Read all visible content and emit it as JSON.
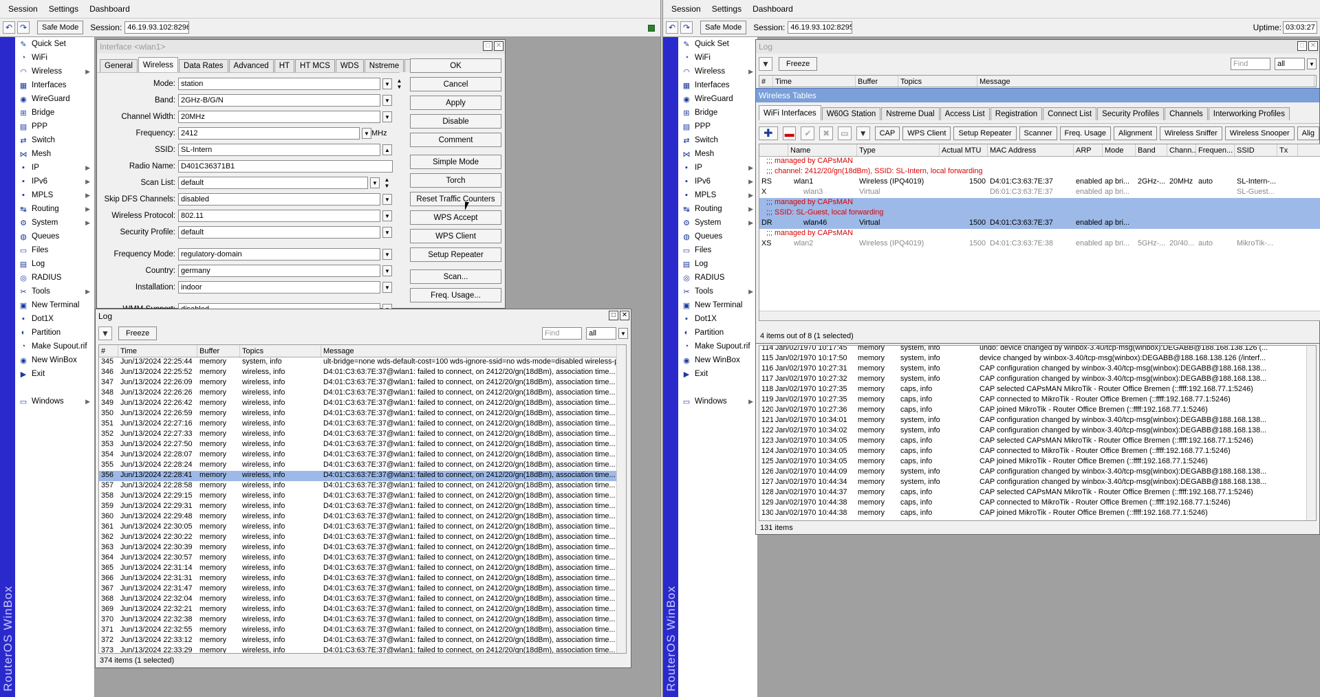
{
  "left": {
    "menu": [
      "Session",
      "Settings",
      "Dashboard"
    ],
    "toolbar": {
      "undo_icon": "undo-icon",
      "redo_icon": "redo-icon",
      "safe_mode": "Safe Mode",
      "session_label": "Session:",
      "session_value": "46.19.93.102:8296"
    },
    "brand": "RouterOS WinBox",
    "sidebar": [
      {
        "label": "Quick Set",
        "icon": "quickset-icon",
        "glyph": "✎"
      },
      {
        "label": "WiFi",
        "icon": "wifi-icon",
        "glyph": "◔"
      },
      {
        "label": "Wireless",
        "icon": "wireless-icon",
        "glyph": "◠",
        "sub": true
      },
      {
        "label": "Interfaces",
        "icon": "interfaces-icon",
        "glyph": "▦"
      },
      {
        "label": "WireGuard",
        "icon": "wireguard-icon",
        "glyph": "◉"
      },
      {
        "label": "Bridge",
        "icon": "bridge-icon",
        "glyph": "⊞"
      },
      {
        "label": "PPP",
        "icon": "ppp-icon",
        "glyph": "▤"
      },
      {
        "label": "Switch",
        "icon": "switch-icon",
        "glyph": "⇄"
      },
      {
        "label": "Mesh",
        "icon": "mesh-icon",
        "glyph": "⋈"
      },
      {
        "label": "IP",
        "icon": "ip-icon",
        "glyph": "▪",
        "sub": true
      },
      {
        "label": "IPv6",
        "icon": "ipv6-icon",
        "glyph": "▪",
        "sub": true
      },
      {
        "label": "MPLS",
        "icon": "mpls-icon",
        "glyph": "▪",
        "sub": true
      },
      {
        "label": "Routing",
        "icon": "routing-icon",
        "glyph": "↹",
        "sub": true
      },
      {
        "label": "System",
        "icon": "system-icon",
        "glyph": "⚙",
        "sub": true
      },
      {
        "label": "Queues",
        "icon": "queues-icon",
        "glyph": "◍"
      },
      {
        "label": "Files",
        "icon": "files-icon",
        "glyph": "▭"
      },
      {
        "label": "Log",
        "icon": "log-icon",
        "glyph": "▤"
      },
      {
        "label": "RADIUS",
        "icon": "radius-icon",
        "glyph": "◎"
      },
      {
        "label": "Tools",
        "icon": "tools-icon",
        "glyph": "✂",
        "sub": true
      },
      {
        "label": "New Terminal",
        "icon": "terminal-icon",
        "glyph": "▣"
      },
      {
        "label": "Dot1X",
        "icon": "dot1x-icon",
        "glyph": "▪"
      },
      {
        "label": "Partition",
        "icon": "partition-icon",
        "glyph": "◐"
      },
      {
        "label": "Make Supout.rif",
        "icon": "supout-icon",
        "glyph": "◔"
      },
      {
        "label": "New WinBox",
        "icon": "winbox-icon",
        "glyph": "◉"
      },
      {
        "label": "Exit",
        "icon": "exit-icon",
        "glyph": "▶"
      },
      {
        "label": "Windows",
        "icon": "windows-icon",
        "glyph": "▭",
        "sub": true,
        "gap": true
      }
    ],
    "iface_window": {
      "title": "Interface <wlan1>",
      "tabs": [
        "General",
        "Wireless",
        "Data Rates",
        "Advanced",
        "HT",
        "HT MCS",
        "WDS",
        "Nstreme",
        "..."
      ],
      "active_tab": "Wireless",
      "fields": [
        {
          "label": "Mode:",
          "value": "station",
          "ctrl": "dd",
          "extra": "▲▼"
        },
        {
          "label": "Band:",
          "value": "2GHz-B/G/N",
          "ctrl": "dd"
        },
        {
          "label": "Channel Width:",
          "value": "20MHz",
          "ctrl": "dd"
        },
        {
          "label": "Frequency:",
          "value": "2412",
          "ctrl": "dd",
          "unit": "MHz"
        },
        {
          "label": "SSID:",
          "value": "SL-Intern",
          "ctrl": "up"
        },
        {
          "label": "Radio Name:",
          "value": "D401C36371B1",
          "ctrl": "none"
        },
        {
          "label": "Scan List:",
          "value": "default",
          "ctrl": "dd",
          "extra": "▲▼"
        },
        {
          "label": "Skip DFS Channels:",
          "value": "disabled",
          "ctrl": "dd"
        },
        {
          "label": "Wireless Protocol:",
          "value": "802.11",
          "ctrl": "dd"
        },
        {
          "label": "Security Profile:",
          "value": "default",
          "ctrl": "dd"
        },
        {
          "label": "Frequency Mode:",
          "value": "regulatory-domain",
          "ctrl": "dd"
        },
        {
          "label": "Country:",
          "value": "germany",
          "ctrl": "dd"
        },
        {
          "label": "Installation:",
          "value": "indoor",
          "ctrl": "dd"
        },
        {
          "label": "WMM Support:",
          "value": "disabled",
          "ctrl": "dd"
        }
      ],
      "buttons": [
        "OK",
        "Cancel",
        "Apply",
        "Disable",
        "Comment",
        "Simple Mode",
        "Torch",
        "Reset Traffic Counters",
        "WPS Accept",
        "WPS Client",
        "Setup Repeater",
        "Scan...",
        "Freq. Usage..."
      ]
    },
    "log_window": {
      "title": "Log",
      "freeze": "Freeze",
      "find_placeholder": "Find",
      "filter": "all",
      "columns": [
        "#",
        "Time",
        "Buffer",
        "Topics",
        "Message"
      ],
      "rows": [
        [
          "345",
          "Jun/13/2024 22:25:44",
          "memory",
          "system, info",
          "ult-bridge=none wds-default-cost=100 wds-ignore-ssid=no wds-mode=disabled wireless-pr..."
        ],
        [
          "346",
          "Jun/13/2024 22:25:52",
          "memory",
          "wireless, info",
          "D4:01:C3:63:7E:37@wlan1: failed to connect, on 2412/20/gn(18dBm), association time..."
        ],
        [
          "347",
          "Jun/13/2024 22:26:09",
          "memory",
          "wireless, info",
          "D4:01:C3:63:7E:37@wlan1: failed to connect, on 2412/20/gn(18dBm), association time..."
        ],
        [
          "348",
          "Jun/13/2024 22:26:26",
          "memory",
          "wireless, info",
          "D4:01:C3:63:7E:37@wlan1: failed to connect, on 2412/20/gn(18dBm), association time..."
        ],
        [
          "349",
          "Jun/13/2024 22:26:42",
          "memory",
          "wireless, info",
          "D4:01:C3:63:7E:37@wlan1: failed to connect, on 2412/20/gn(18dBm), association time..."
        ],
        [
          "350",
          "Jun/13/2024 22:26:59",
          "memory",
          "wireless, info",
          "D4:01:C3:63:7E:37@wlan1: failed to connect, on 2412/20/gn(18dBm), association time..."
        ],
        [
          "351",
          "Jun/13/2024 22:27:16",
          "memory",
          "wireless, info",
          "D4:01:C3:63:7E:37@wlan1: failed to connect, on 2412/20/gn(18dBm), association time..."
        ],
        [
          "352",
          "Jun/13/2024 22:27:33",
          "memory",
          "wireless, info",
          "D4:01:C3:63:7E:37@wlan1: failed to connect, on 2412/20/gn(18dBm), association time..."
        ],
        [
          "353",
          "Jun/13/2024 22:27:50",
          "memory",
          "wireless, info",
          "D4:01:C3:63:7E:37@wlan1: failed to connect, on 2412/20/gn(18dBm), association time..."
        ],
        [
          "354",
          "Jun/13/2024 22:28:07",
          "memory",
          "wireless, info",
          "D4:01:C3:63:7E:37@wlan1: failed to connect, on 2412/20/gn(18dBm), association time..."
        ],
        [
          "355",
          "Jun/13/2024 22:28:24",
          "memory",
          "wireless, info",
          "D4:01:C3:63:7E:37@wlan1: failed to connect, on 2412/20/gn(18dBm), association time..."
        ],
        [
          "356",
          "Jun/13/2024 22:28:41",
          "memory",
          "wireless, info",
          "D4:01:C3:63:7E:37@wlan1: failed to connect, on 2412/20/gn(18dBm), association time..."
        ],
        [
          "357",
          "Jun/13/2024 22:28:58",
          "memory",
          "wireless, info",
          "D4:01:C3:63:7E:37@wlan1: failed to connect, on 2412/20/gn(18dBm), association time..."
        ],
        [
          "358",
          "Jun/13/2024 22:29:15",
          "memory",
          "wireless, info",
          "D4:01:C3:63:7E:37@wlan1: failed to connect, on 2412/20/gn(18dBm), association time..."
        ],
        [
          "359",
          "Jun/13/2024 22:29:31",
          "memory",
          "wireless, info",
          "D4:01:C3:63:7E:37@wlan1: failed to connect, on 2412/20/gn(18dBm), association time..."
        ],
        [
          "360",
          "Jun/13/2024 22:29:48",
          "memory",
          "wireless, info",
          "D4:01:C3:63:7E:37@wlan1: failed to connect, on 2412/20/gn(18dBm), association time..."
        ],
        [
          "361",
          "Jun/13/2024 22:30:05",
          "memory",
          "wireless, info",
          "D4:01:C3:63:7E:37@wlan1: failed to connect, on 2412/20/gn(18dBm), association time..."
        ],
        [
          "362",
          "Jun/13/2024 22:30:22",
          "memory",
          "wireless, info",
          "D4:01:C3:63:7E:37@wlan1: failed to connect, on 2412/20/gn(18dBm), association time..."
        ],
        [
          "363",
          "Jun/13/2024 22:30:39",
          "memory",
          "wireless, info",
          "D4:01:C3:63:7E:37@wlan1: failed to connect, on 2412/20/gn(18dBm), association time..."
        ],
        [
          "364",
          "Jun/13/2024 22:30:57",
          "memory",
          "wireless, info",
          "D4:01:C3:63:7E:37@wlan1: failed to connect, on 2412/20/gn(18dBm), association time..."
        ],
        [
          "365",
          "Jun/13/2024 22:31:14",
          "memory",
          "wireless, info",
          "D4:01:C3:63:7E:37@wlan1: failed to connect, on 2412/20/gn(18dBm), association time..."
        ],
        [
          "366",
          "Jun/13/2024 22:31:31",
          "memory",
          "wireless, info",
          "D4:01:C3:63:7E:37@wlan1: failed to connect, on 2412/20/gn(18dBm), association time..."
        ],
        [
          "367",
          "Jun/13/2024 22:31:47",
          "memory",
          "wireless, info",
          "D4:01:C3:63:7E:37@wlan1: failed to connect, on 2412/20/gn(18dBm), association time..."
        ],
        [
          "368",
          "Jun/13/2024 22:32:04",
          "memory",
          "wireless, info",
          "D4:01:C3:63:7E:37@wlan1: failed to connect, on 2412/20/gn(18dBm), association time..."
        ],
        [
          "369",
          "Jun/13/2024 22:32:21",
          "memory",
          "wireless, info",
          "D4:01:C3:63:7E:37@wlan1: failed to connect, on 2412/20/gn(18dBm), association time..."
        ],
        [
          "370",
          "Jun/13/2024 22:32:38",
          "memory",
          "wireless, info",
          "D4:01:C3:63:7E:37@wlan1: failed to connect, on 2412/20/gn(18dBm), association time..."
        ],
        [
          "371",
          "Jun/13/2024 22:32:55",
          "memory",
          "wireless, info",
          "D4:01:C3:63:7E:37@wlan1: failed to connect, on 2412/20/gn(18dBm), association time..."
        ],
        [
          "372",
          "Jun/13/2024 22:33:12",
          "memory",
          "wireless, info",
          "D4:01:C3:63:7E:37@wlan1: failed to connect, on 2412/20/gn(18dBm), association time..."
        ],
        [
          "373",
          "Jun/13/2024 22:33:29",
          "memory",
          "wireless, info",
          "D4:01:C3:63:7E:37@wlan1: failed to connect, on 2412/20/gn(18dBm), association time..."
        ]
      ],
      "selected": "356",
      "status": "374 items (1 selected)"
    }
  },
  "right": {
    "menu": [
      "Session",
      "Settings",
      "Dashboard"
    ],
    "toolbar": {
      "safe_mode": "Safe Mode",
      "session_label": "Session:",
      "session_value": "46.19.93.102:8295",
      "uptime_label": "Uptime:",
      "uptime_value": "03:03:27"
    },
    "brand": "RouterOS WinBox",
    "log_window": {
      "title": "Log",
      "freeze": "Freeze",
      "find_placeholder": "Find",
      "filter": "all",
      "columns": [
        "#",
        "Time",
        "Buffer",
        "Topics",
        "Message"
      ],
      "rows": [
        [
          "114",
          "Jan/02/1970 10:17:45",
          "memory",
          "system, info",
          "undo: device changed by winbox-3.40/tcp-msg(winbox):DEGABB@188.168.138.126 (..."
        ],
        [
          "115",
          "Jan/02/1970 10:17:50",
          "memory",
          "system, info",
          "device changed by winbox-3.40/tcp-msg(winbox):DEGABB@188.168.138.126 (/interf..."
        ],
        [
          "116",
          "Jan/02/1970 10:27:31",
          "memory",
          "system, info",
          "CAP configuration changed by winbox-3.40/tcp-msg(winbox):DEGABB@188.168.138..."
        ],
        [
          "117",
          "Jan/02/1970 10:27:32",
          "memory",
          "system, info",
          "CAP configuration changed by winbox-3.40/tcp-msg(winbox):DEGABB@188.168.138..."
        ],
        [
          "118",
          "Jan/02/1970 10:27:35",
          "memory",
          "caps, info",
          "CAP selected CAPsMAN MikroTik - Router Office Bremen (::ffff:192.168.77.1:5246)"
        ],
        [
          "119",
          "Jan/02/1970 10:27:35",
          "memory",
          "caps, info",
          "CAP connected to MikroTik - Router Office Bremen (::ffff:192.168.77.1:5246)"
        ],
        [
          "120",
          "Jan/02/1970 10:27:36",
          "memory",
          "caps, info",
          "CAP joined MikroTik - Router Office Bremen (::ffff:192.168.77.1:5246)"
        ],
        [
          "121",
          "Jan/02/1970 10:34:01",
          "memory",
          "system, info",
          "CAP configuration changed by winbox-3.40/tcp-msg(winbox):DEGABB@188.168.138..."
        ],
        [
          "122",
          "Jan/02/1970 10:34:02",
          "memory",
          "system, info",
          "CAP configuration changed by winbox-3.40/tcp-msg(winbox):DEGABB@188.168.138..."
        ],
        [
          "123",
          "Jan/02/1970 10:34:05",
          "memory",
          "caps, info",
          "CAP selected CAPsMAN MikroTik - Router Office Bremen (::ffff:192.168.77.1:5246)"
        ],
        [
          "124",
          "Jan/02/1970 10:34:05",
          "memory",
          "caps, info",
          "CAP connected to MikroTik - Router Office Bremen (::ffff:192.168.77.1:5246)"
        ],
        [
          "125",
          "Jan/02/1970 10:34:05",
          "memory",
          "caps, info",
          "CAP joined MikroTik - Router Office Bremen (::ffff:192.168.77.1:5246)"
        ],
        [
          "126",
          "Jan/02/1970 10:44:09",
          "memory",
          "system, info",
          "CAP configuration changed by winbox-3.40/tcp-msg(winbox):DEGABB@188.168.138..."
        ],
        [
          "127",
          "Jan/02/1970 10:44:34",
          "memory",
          "system, info",
          "CAP configuration changed by winbox-3.40/tcp-msg(winbox):DEGABB@188.168.138..."
        ],
        [
          "128",
          "Jan/02/1970 10:44:37",
          "memory",
          "caps, info",
          "CAP selected CAPsMAN MikroTik - Router Office Bremen (::ffff:192.168.77.1:5246)"
        ],
        [
          "129",
          "Jan/02/1970 10:44:38",
          "memory",
          "caps, info",
          "CAP connected to MikroTik - Router Office Bremen (::ffff:192.168.77.1:5246)"
        ],
        [
          "130",
          "Jan/02/1970 10:44:38",
          "memory",
          "caps, info",
          "CAP joined MikroTik - Router Office Bremen (::ffff:192.168.77.1:5246)"
        ]
      ],
      "status": "131 items"
    },
    "wt_window": {
      "title": "Wireless Tables",
      "tabs": [
        "WiFi Interfaces",
        "W60G Station",
        "Nstreme Dual",
        "Access List",
        "Registration",
        "Connect List",
        "Security Profiles",
        "Channels",
        "Interworking Profiles"
      ],
      "active_tab": "WiFi Interfaces",
      "buttons": [
        "CAP",
        "WPS Client",
        "Setup Repeater",
        "Scanner",
        "Freq. Usage",
        "Alignment",
        "Wireless Sniffer",
        "Wireless Snooper",
        "Alig"
      ],
      "columns": [
        "",
        "Name",
        "Type",
        "Actual MTU",
        "MAC Address",
        "ARP",
        "Mode",
        "Band",
        "Chann...",
        "Frequen...",
        "SSID",
        "Tx"
      ],
      "rows": [
        {
          "kind": "comment",
          "text": ";;; managed by CAPsMAN"
        },
        {
          "kind": "comment",
          "text": ";;; channel: 2412/20/gn(18dBm), SSID: SL-Intern, local forwarding"
        },
        {
          "kind": "row",
          "flag": "RS",
          "name": "wlan1",
          "type": "Wireless (IPQ4019)",
          "mtu": "1500",
          "mac": "D4:01:C3:63:7E:37",
          "arp": "enabled",
          "mode": "ap bri...",
          "band": "2GHz-...",
          "chan": "20MHz",
          "freq": "auto",
          "ssid": "SL-Intern-..."
        },
        {
          "kind": "row",
          "flag": "X",
          "name": "wlan3",
          "type": "Virtual",
          "mtu": "",
          "mac": "D6:01:C3:63:7E:37",
          "arp": "enabled",
          "mode": "ap bri...",
          "band": "",
          "chan": "",
          "freq": "",
          "ssid": "SL-Guest...",
          "disabled": true
        },
        {
          "kind": "comment",
          "text": ";;; managed by CAPsMAN",
          "sel": true
        },
        {
          "kind": "comment",
          "text": ";;; SSID: SL-Guest, local forwarding",
          "sel": true
        },
        {
          "kind": "row",
          "flag": "DR",
          "name": "wlan46",
          "type": "Virtual",
          "mtu": "1500",
          "mac": "D4:01:C3:63:7E:37",
          "arp": "enabled",
          "mode": "ap bri...",
          "band": "",
          "chan": "",
          "freq": "",
          "ssid": "",
          "sel": true
        },
        {
          "kind": "comment",
          "text": ";;; managed by CAPsMAN"
        },
        {
          "kind": "row",
          "flag": "XS",
          "name": "wlan2",
          "type": "Wireless (IPQ4019)",
          "mtu": "1500",
          "mac": "D4:01:C3:63:7E:38",
          "arp": "enabled",
          "mode": "ap bri...",
          "band": "5GHz-...",
          "chan": "20/40...",
          "freq": "auto",
          "ssid": "MikroTik-...",
          "disabled": true
        }
      ],
      "status": "4 items out of 8 (1 selected)"
    }
  }
}
